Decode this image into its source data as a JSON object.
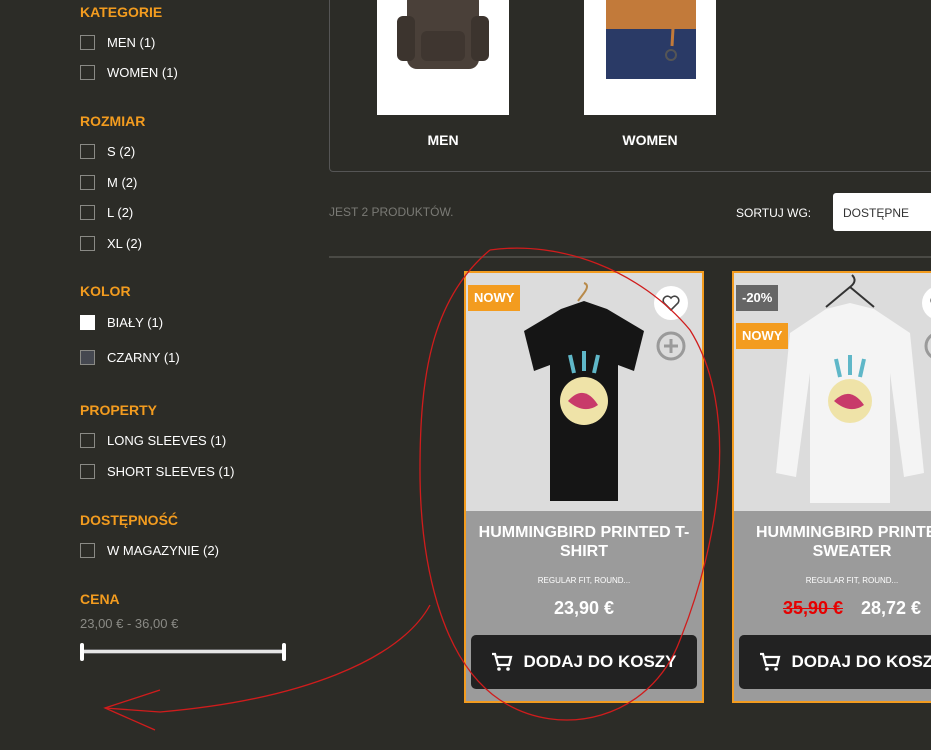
{
  "filters": {
    "categories": {
      "title": "KATEGORIE",
      "items": [
        {
          "label": "MEN (1)"
        },
        {
          "label": "WOMEN (1)"
        }
      ]
    },
    "size": {
      "title": "ROZMIAR",
      "items": [
        {
          "label": "S (2)"
        },
        {
          "label": "M (2)"
        },
        {
          "label": "L (2)"
        },
        {
          "label": "XL (2)"
        }
      ]
    },
    "color": {
      "title": "KOLOR",
      "items": [
        {
          "label": "BIAŁY (1)",
          "swatch": "#ffffff"
        },
        {
          "label": "CZARNY (1)",
          "swatch": "#454850"
        }
      ]
    },
    "property": {
      "title": "PROPERTY",
      "items": [
        {
          "label": "LONG SLEEVES (1)"
        },
        {
          "label": "SHORT SLEEVES (1)"
        }
      ]
    },
    "availability": {
      "title": "DOSTĘPNOŚĆ",
      "items": [
        {
          "label": "W MAGAZYNIE (2)"
        }
      ]
    },
    "price": {
      "title": "CENA",
      "range": "23,00 € - 36,00 €",
      "min_selected": 0,
      "max_selected": 1
    }
  },
  "categories_block": {
    "items": [
      {
        "name": "MEN"
      },
      {
        "name": "WOMEN"
      }
    ]
  },
  "listing": {
    "count_text": "JEST 2 PRODUKTÓW.",
    "sort_label": "SORTUJ WG:",
    "sort_value": "DOSTĘPNE"
  },
  "products": [
    {
      "badges": [
        "NOWY"
      ],
      "title": "HUMMINGBIRD PRINTED T-\nSHIRT",
      "description": "REGULAR FIT, ROUND...",
      "price": "23,90 €",
      "button": "DODAJ DO KOSZY"
    },
    {
      "badges": [
        "-20%",
        "NOWY"
      ],
      "title": "HUMMINGBIRD PRINTED\nSWEATER",
      "description": "REGULAR FIT, ROUND...",
      "old_price": "35,90 €",
      "price": "28,72 €",
      "button": "DODAJ DO KOSZY"
    }
  ],
  "colors": {
    "accent": "#f39c1f",
    "background": "#2c2c27",
    "annotation": "#d01c1c"
  }
}
